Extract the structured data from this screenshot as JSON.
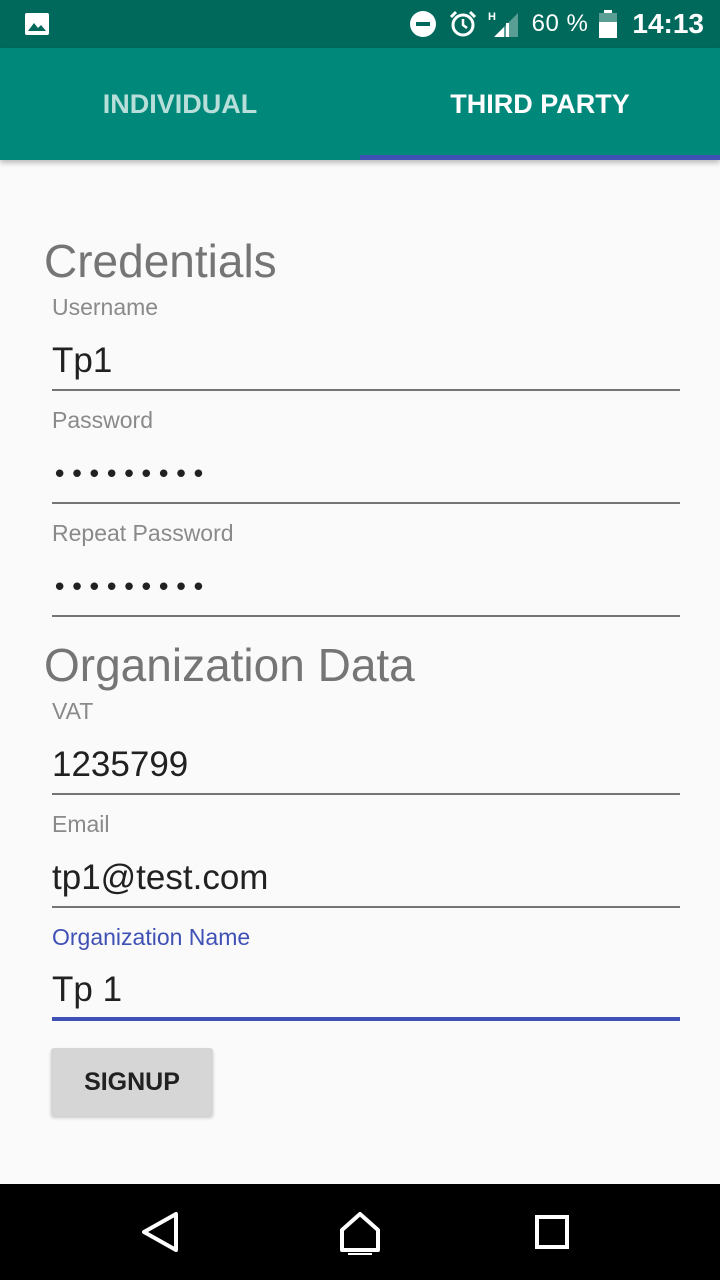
{
  "status_bar": {
    "battery_percent": "60 %",
    "time": "14:13",
    "network_type": "H",
    "icons": [
      "gallery-icon",
      "do-not-disturb-icon",
      "alarm-icon",
      "signal-icon",
      "battery-icon"
    ]
  },
  "tabs": [
    {
      "label": "INDIVIDUAL",
      "selected": false
    },
    {
      "label": "THIRD PARTY",
      "selected": true
    }
  ],
  "colors": {
    "status_bar": "#00695c",
    "toolbar": "#00897b",
    "accent": "#3f51b5",
    "background": "#fafafa"
  },
  "credentials": {
    "title": "Credentials",
    "username": {
      "label": "Username",
      "value": "Tp1"
    },
    "password": {
      "label": "Password",
      "value": "•••••••••"
    },
    "repeat_password": {
      "label": "Repeat Password",
      "value": "•••••••••"
    }
  },
  "organization": {
    "title": "Organization Data",
    "vat": {
      "label": "VAT",
      "value": "1235799"
    },
    "email": {
      "label": "Email",
      "value": "tp1@test.com"
    },
    "name": {
      "label": "Organization Name",
      "value": "Tp 1"
    }
  },
  "signup_label": "SIGNUP",
  "nav_bar": {
    "icons": [
      "back-icon",
      "home-icon",
      "recents-icon"
    ]
  }
}
